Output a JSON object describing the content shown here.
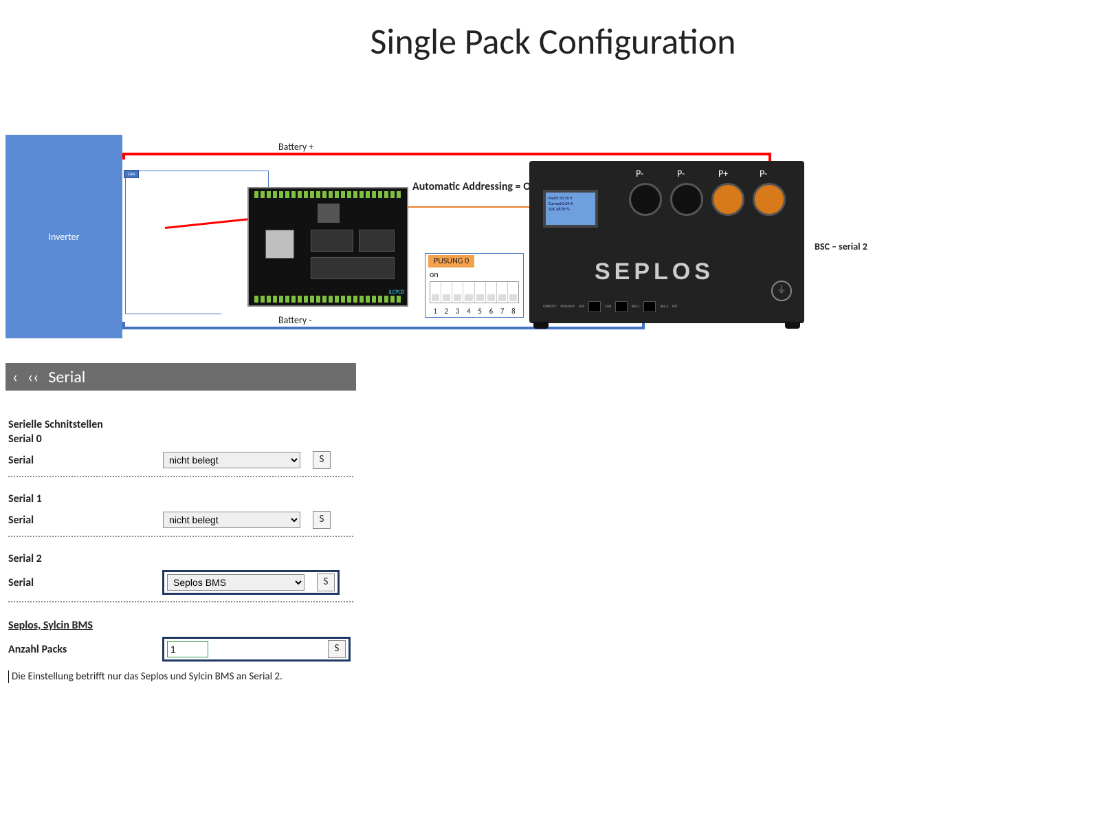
{
  "title": "Single Pack Configuration",
  "diagram": {
    "inverter_label": "Inverter",
    "can_label": "CAN",
    "battery_plus": "Battery +",
    "battery_minus": "Battery -",
    "auto_addressing": "Automatic Addressing = OFF",
    "bsc_serial": "BSC – serial 2",
    "dip": {
      "badge": "PUSUNG 0",
      "on": "on",
      "numbers": [
        "1",
        "2",
        "3",
        "4",
        "5",
        "6",
        "7",
        "8"
      ]
    },
    "battery": {
      "terminals": [
        "P-",
        "P-",
        "P+",
        "P-"
      ],
      "logo": "SEPLOS",
      "screen_lines": [
        "PackV 50.70 V",
        "Current 0.04 A",
        "SOC 48.89 %"
      ],
      "port_labels": [
        "CAPACITY",
        "RUN/ALM",
        "ADS",
        "CAN",
        "485-1",
        "485-2",
        "RST"
      ]
    },
    "pcb_footer": "JLCPCB"
  },
  "config": {
    "nav_back_single": "‹",
    "nav_back_double": "‹‹",
    "header_title": "Serial",
    "section_title": "Serielle Schnitstellen",
    "serials": [
      {
        "name": "Serial 0",
        "field": "Serial",
        "value": "nicht belegt",
        "button": "S",
        "highlight": false
      },
      {
        "name": "Serial 1",
        "field": "Serial",
        "value": "nicht belegt",
        "button": "S",
        "highlight": false
      },
      {
        "name": "Serial 2",
        "field": "Serial",
        "value": "Seplos BMS",
        "button": "S",
        "highlight": true
      }
    ],
    "sub_section": "Seplos, Sylcin BMS",
    "packs": {
      "label": "Anzahl Packs",
      "value": "1",
      "button": "S"
    },
    "note": "Die Einstellung betrifft nur das Seplos und Sylcin BMS an Serial 2."
  }
}
